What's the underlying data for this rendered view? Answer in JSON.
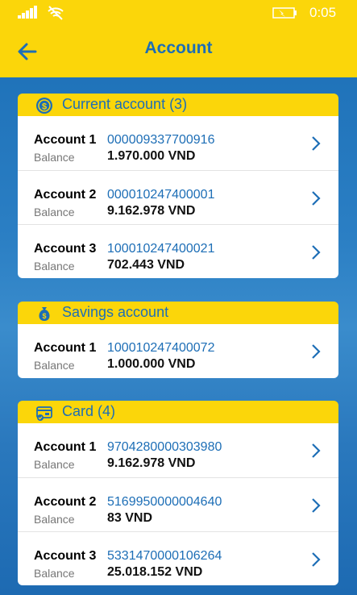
{
  "status": {
    "time": "0:05"
  },
  "header": {
    "title": "Account"
  },
  "sections": [
    {
      "title": "Current account (3)",
      "icon": "coin-icon",
      "rows": [
        {
          "label": "Account 1",
          "number": "000009337700916",
          "balance_label": "Balance",
          "balance": "1.970.000 VND"
        },
        {
          "label": "Account 2",
          "number": "000010247400001",
          "balance_label": "Balance",
          "balance": "9.162.978 VND"
        },
        {
          "label": "Account 3",
          "number": "100010247400021",
          "balance_label": "Balance",
          "balance": "702.443 VND"
        }
      ]
    },
    {
      "title": "Savings account",
      "icon": "money-bag-icon",
      "rows": [
        {
          "label": "Account 1",
          "number": "100010247400072",
          "balance_label": "Balance",
          "balance": "1.000.000 VND"
        }
      ]
    },
    {
      "title": "Card (4)",
      "icon": "card-icon",
      "rows": [
        {
          "label": "Account 1",
          "number": "9704280000303980",
          "balance_label": "Balance",
          "balance": "9.162.978 VND"
        },
        {
          "label": "Account 2",
          "number": "5169950000004640",
          "balance_label": "Balance",
          "balance": "83 VND"
        },
        {
          "label": "Account 3",
          "number": "5331470000106264",
          "balance_label": "Balance",
          "balance": "25.018.152 VND"
        }
      ]
    }
  ],
  "colors": {
    "accent": "#fbd60a",
    "brand_blue": "#1d6eb6"
  }
}
